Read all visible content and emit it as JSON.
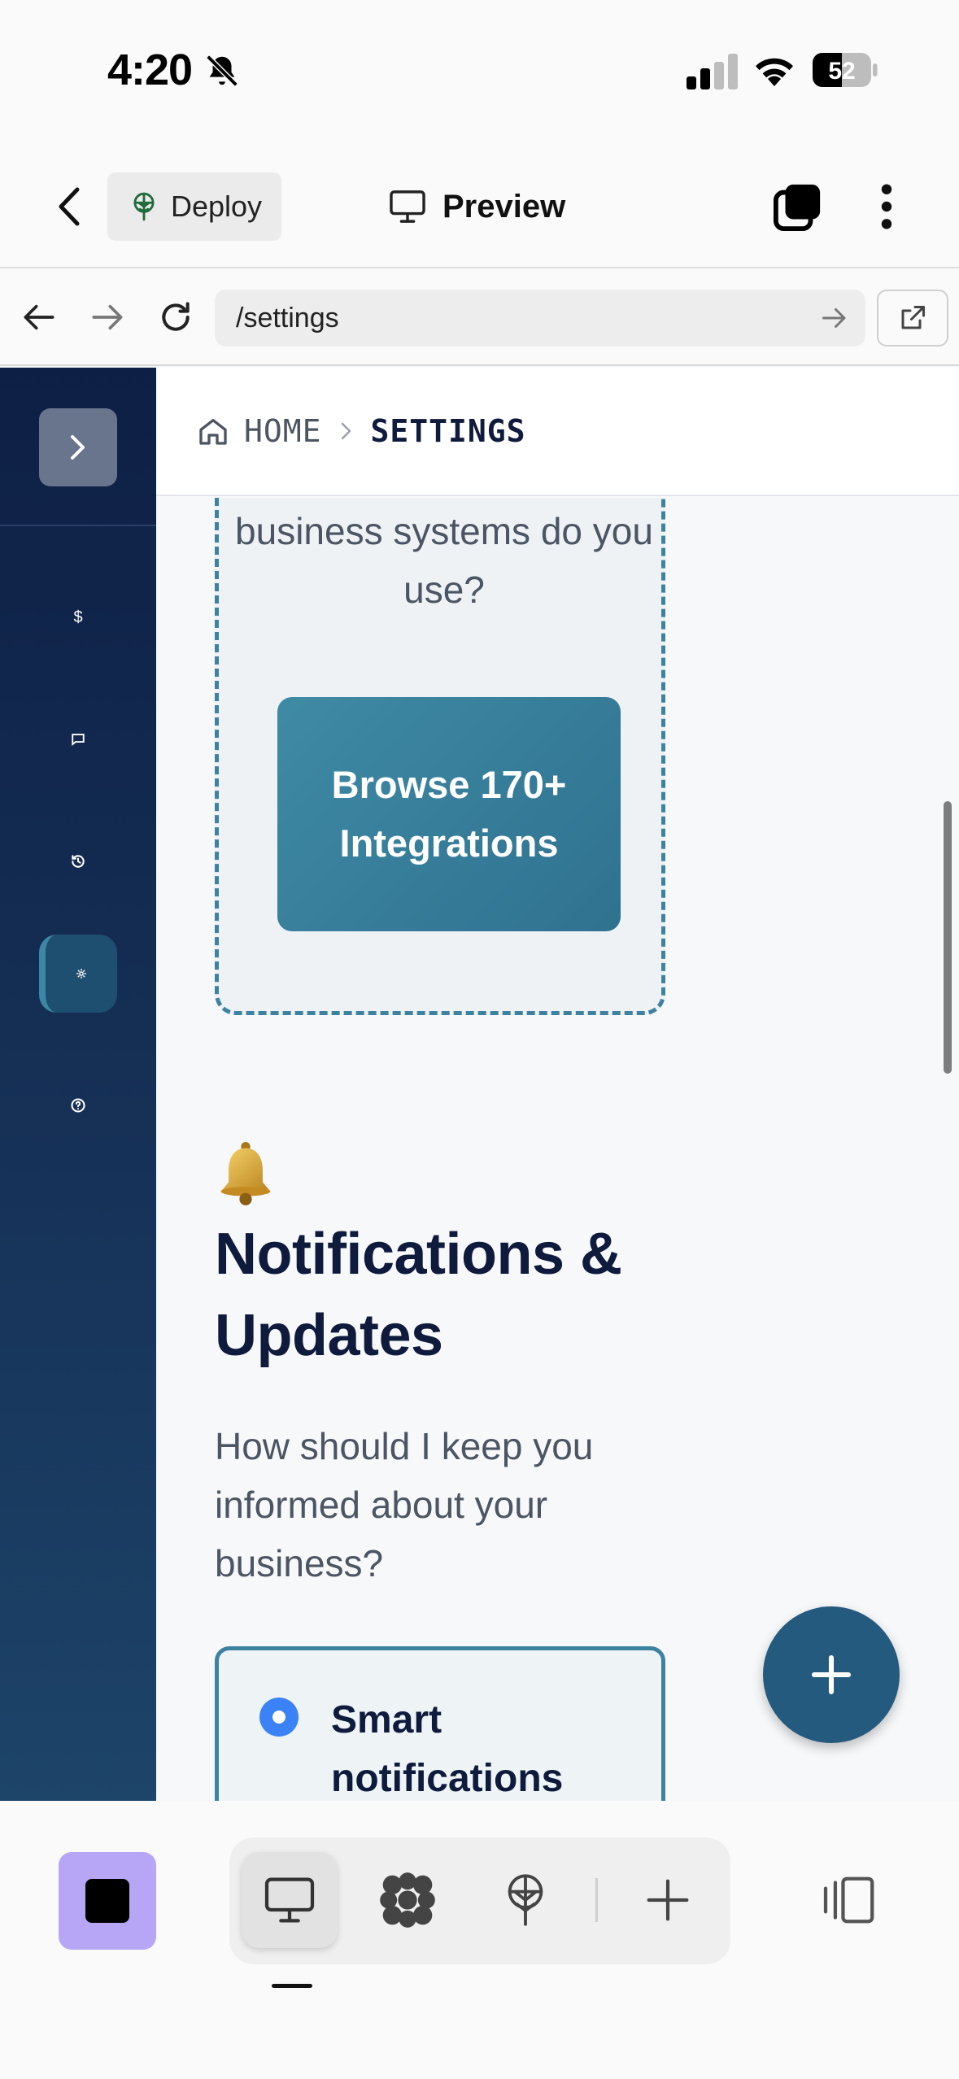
{
  "status_bar": {
    "time": "4:20",
    "battery_level": "52"
  },
  "app_bar": {
    "deploy_label": "Deploy",
    "preview_label": "Preview"
  },
  "browser": {
    "url": "/settings"
  },
  "breadcrumb": {
    "home": "HOME",
    "current": "SETTINGS"
  },
  "sidebar": {
    "items": [
      {
        "name": "billing",
        "glyph": "$"
      },
      {
        "name": "messages",
        "glyph": "▭"
      },
      {
        "name": "history",
        "glyph": "⟲"
      },
      {
        "name": "settings",
        "glyph": "✻"
      },
      {
        "name": "help",
        "glyph": "?"
      }
    ]
  },
  "integrations": {
    "question": "business systems do you use?",
    "button_label": "Browse 170+ Integrations"
  },
  "notifications": {
    "icon": "bell-emoji",
    "title": "Notifications & Updates",
    "subtitle": "How should I keep you informed about your business?",
    "options": [
      {
        "label": "Smart notifications",
        "selected": true
      }
    ]
  },
  "colors": {
    "sidebar_bg": "#0e1f45",
    "accent": "#3d82a0",
    "fab": "#245a7e",
    "radio": "#3b82f6",
    "stop_button": "#b7a6f5"
  }
}
